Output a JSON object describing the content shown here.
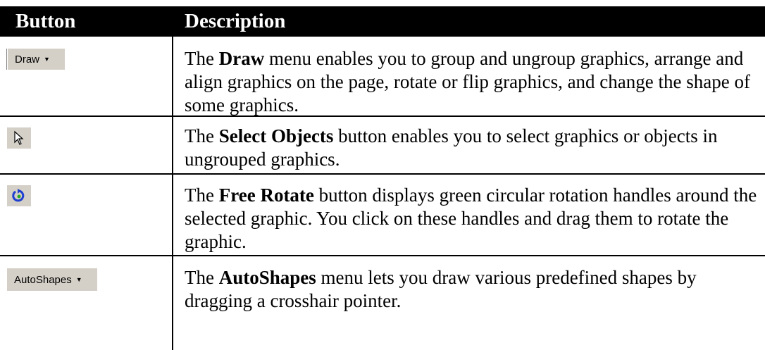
{
  "header": {
    "col_button": "Button",
    "col_description": "Description"
  },
  "rows": [
    {
      "button_label": "Draw",
      "icon": "draw-menu-button",
      "desc_pre": "The ",
      "desc_bold": "Draw",
      "desc_post": " menu enables you to group and ungroup graphics, arrange and align graphics on the page, rotate or flip graphics, and change the shape of some graphics."
    },
    {
      "button_label": "",
      "icon": "arrow-pointer-icon",
      "desc_pre": "The ",
      "desc_bold": "Select Objects",
      "desc_post": "  button enables you to select graphics or objects in ungrouped graphics."
    },
    {
      "button_label": "",
      "icon": "free-rotate-icon",
      "desc_pre": "The ",
      "desc_bold": "Free Rotate",
      "desc_post": " button displays green circular rotation handles around the selected graphic. You click on these handles and drag them to rotate the graphic."
    },
    {
      "button_label": "AutoShapes",
      "icon": "autoshapes-menu-button",
      "desc_pre": "The ",
      "desc_bold": "AutoShapes",
      "desc_post": " menu lets you draw various predefined shapes by dragging a crosshair pointer."
    }
  ],
  "colors": {
    "header_bg": "#000000",
    "header_text": "#ffffff",
    "button_face": "#d4d0c8",
    "rotate_blue": "#1f3fd0",
    "rotate_green": "#2aa82a"
  }
}
